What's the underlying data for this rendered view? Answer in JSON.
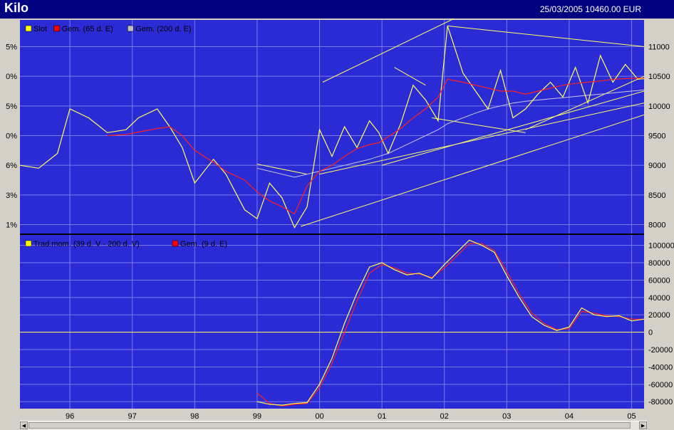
{
  "window": {
    "title": "Kilo",
    "info": "25/03/2005 10460.00 EUR"
  },
  "colors": {
    "background": "#2b2bd6",
    "price": "#ffff55",
    "average": "#ff2020",
    "grid": "#7b7bea",
    "trend": "#ffff66"
  },
  "chart_data": [
    {
      "type": "line",
      "legend": [
        {
          "label": "Slot",
          "color": "#ffff00"
        },
        {
          "label": "Gem. (65 d. E)",
          "color": "#ff0000"
        },
        {
          "label": "Gem. (200 d. E)",
          "color": "#c0c0c0"
        }
      ],
      "x_ticks": [
        "96",
        "97",
        "98",
        "99",
        "00",
        "01",
        "02",
        "03",
        "04",
        "05"
      ],
      "right_ticks": [
        "11000",
        "10500",
        "10000",
        "9500",
        "9000",
        "8500",
        "8000"
      ],
      "left_ticks": [
        "5%",
        "0%",
        "5%",
        "0%",
        "6%",
        "3%",
        "1%"
      ],
      "ylim": [
        7850,
        11450
      ],
      "x": [
        1995.2,
        1995.5,
        1995.8,
        1996.0,
        1996.3,
        1996.6,
        1996.9,
        1997.1,
        1997.4,
        1997.6,
        1997.8,
        1998.0,
        1998.3,
        1998.5,
        1998.8,
        1999.0,
        1999.2,
        1999.4,
        1999.6,
        1999.8,
        2000.0,
        2000.2,
        2000.4,
        2000.6,
        2000.8,
        2000.95,
        2001.1,
        2001.3,
        2001.5,
        2001.7,
        2001.9,
        2002.05,
        2002.3,
        2002.5,
        2002.7,
        2002.9,
        2003.1,
        2003.3,
        2003.5,
        2003.7,
        2003.9,
        2004.1,
        2004.3,
        2004.5,
        2004.7,
        2004.9,
        2005.1,
        2005.2
      ],
      "price": [
        9000,
        8950,
        9200,
        9950,
        9800,
        9550,
        9600,
        9800,
        9950,
        9650,
        9300,
        8700,
        9100,
        8850,
        8250,
        8100,
        8700,
        8450,
        7950,
        8300,
        9600,
        9150,
        9650,
        9300,
        9750,
        9550,
        9200,
        9700,
        10350,
        10100,
        9750,
        11350,
        10550,
        10250,
        9950,
        10600,
        9800,
        9950,
        10200,
        10400,
        10150,
        10650,
        10050,
        10850,
        10400,
        10700,
        10450,
        10460
      ],
      "ma65": [
        null,
        null,
        null,
        null,
        null,
        9500,
        9520,
        9560,
        9620,
        9650,
        9500,
        9250,
        9050,
        8900,
        8750,
        8550,
        8400,
        8300,
        8180,
        8650,
        8900,
        9000,
        9150,
        9280,
        9350,
        9380,
        9480,
        9620,
        9800,
        9950,
        10150,
        10450,
        10400,
        10350,
        10300,
        10250,
        10250,
        10200,
        10250,
        10300,
        10350,
        10380,
        10400,
        10420,
        10450,
        10460,
        10470,
        10470
      ],
      "ma200": [
        null,
        null,
        null,
        null,
        null,
        null,
        null,
        null,
        null,
        null,
        null,
        null,
        null,
        null,
        null,
        8950,
        8900,
        8850,
        8800,
        8850,
        8900,
        8950,
        9000,
        9050,
        9100,
        9150,
        9200,
        9300,
        9400,
        9500,
        9600,
        9700,
        9800,
        9880,
        9950,
        10000,
        10050,
        10080,
        10100,
        10120,
        10140,
        10160,
        10180,
        10200,
        10220,
        10240,
        10260,
        10270
      ]
    },
    {
      "type": "line",
      "legend": [
        {
          "label": "Trad.mom. (39 d. V - 200 d. V)",
          "color": "#ffff00"
        },
        {
          "label": "Gem. (9 d. E)",
          "color": "#ff0000"
        }
      ],
      "right_ticks": [
        "100000",
        "80000",
        "60000",
        "40000",
        "20000",
        "0",
        "-20000",
        "-40000",
        "-60000",
        "-80000"
      ],
      "ylim": [
        -88000,
        112000
      ],
      "x": [
        1999.0,
        1999.2,
        1999.4,
        1999.6,
        1999.8,
        2000.0,
        2000.2,
        2000.4,
        2000.6,
        2000.8,
        2001.0,
        2001.2,
        2001.4,
        2001.6,
        2001.8,
        2002.0,
        2002.2,
        2002.4,
        2002.6,
        2002.8,
        2003.0,
        2003.2,
        2003.4,
        2003.6,
        2003.8,
        2004.0,
        2004.2,
        2004.4,
        2004.6,
        2004.8,
        2005.0,
        2005.2
      ],
      "momentum": [
        -80000,
        -83000,
        -84000,
        -82000,
        -81000,
        -60000,
        -30000,
        10000,
        45000,
        75000,
        80000,
        72000,
        66000,
        68000,
        62000,
        78000,
        92000,
        106000,
        100000,
        92000,
        65000,
        40000,
        18000,
        8000,
        2000,
        6000,
        28000,
        20000,
        18000,
        19000,
        13000,
        15000
      ],
      "avg9": [
        -70000,
        -82000,
        -85000,
        -83000,
        -82000,
        -64000,
        -36000,
        0,
        36000,
        68000,
        78000,
        74000,
        68000,
        67000,
        63000,
        74000,
        88000,
        102000,
        102000,
        94000,
        70000,
        44000,
        22000,
        10000,
        3000,
        4000,
        24000,
        22000,
        19000,
        18000,
        15000,
        15000
      ]
    }
  ]
}
